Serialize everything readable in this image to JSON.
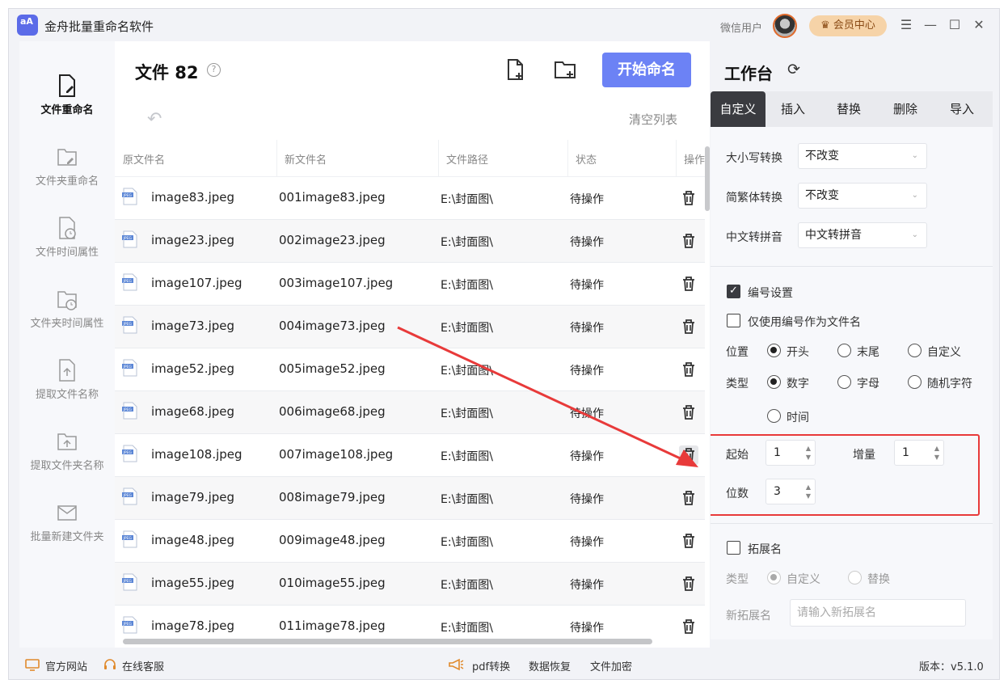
{
  "app": {
    "logo_text": "aA",
    "title": "金舟批量重命名软件",
    "user_name": "微信用户",
    "vip_label": "会员中心",
    "controls": [
      "menu-icon",
      "minimize-icon",
      "maximize-icon",
      "close-icon"
    ]
  },
  "nav": {
    "items": [
      {
        "label": "文件重命名",
        "icon": "file-edit-icon",
        "active": true
      },
      {
        "label": "文件夹重命名",
        "icon": "folder-edit-icon",
        "active": false
      },
      {
        "label": "文件时间属性",
        "icon": "file-clock-icon",
        "active": false
      },
      {
        "label": "文件夹时间属性",
        "icon": "folder-clock-icon",
        "active": false
      },
      {
        "label": "提取文件名称",
        "icon": "file-upload-icon",
        "active": false
      },
      {
        "label": "提取文件夹名称",
        "icon": "folder-upload-icon",
        "active": false
      },
      {
        "label": "批量新建文件夹",
        "icon": "mail-folder-icon",
        "active": false
      }
    ]
  },
  "files": {
    "title": "文件 82",
    "help_symbol": "?",
    "start_label": "开始命名",
    "clear_label": "清空列表",
    "undo_symbol": "↶",
    "columns": [
      "原文件名",
      "新文件名",
      "文件路径",
      "状态",
      "操作"
    ],
    "rows": [
      {
        "orig": "image83.jpeg",
        "new": "001image83.jpeg",
        "path": "E:\\封面图\\",
        "status": "待操作"
      },
      {
        "orig": "image23.jpeg",
        "new": "002image23.jpeg",
        "path": "E:\\封面图\\",
        "status": "待操作"
      },
      {
        "orig": "image107.jpeg",
        "new": "003image107.jpeg",
        "path": "E:\\封面图\\",
        "status": "待操作"
      },
      {
        "orig": "image73.jpeg",
        "new": "004image73.jpeg",
        "path": "E:\\封面图\\",
        "status": "待操作"
      },
      {
        "orig": "image52.jpeg",
        "new": "005image52.jpeg",
        "path": "E:\\封面图\\",
        "status": "待操作"
      },
      {
        "orig": "image68.jpeg",
        "new": "006image68.jpeg",
        "path": "E:\\封面图\\",
        "status": "待操作"
      },
      {
        "orig": "image108.jpeg",
        "new": "007image108.jpeg",
        "path": "E:\\封面图\\",
        "status": "待操作"
      },
      {
        "orig": "image79.jpeg",
        "new": "008image79.jpeg",
        "path": "E:\\封面图\\",
        "status": "待操作"
      },
      {
        "orig": "image48.jpeg",
        "new": "009image48.jpeg",
        "path": "E:\\封面图\\",
        "status": "待操作"
      },
      {
        "orig": "image55.jpeg",
        "new": "010image55.jpeg",
        "path": "E:\\封面图\\",
        "status": "待操作"
      },
      {
        "orig": "image78.jpeg",
        "new": "011image78.jpeg",
        "path": "E:\\封面图\\",
        "status": "待操作"
      }
    ]
  },
  "workspace": {
    "title": "工作台",
    "tabs": [
      "自定义",
      "插入",
      "替换",
      "删除",
      "导入"
    ],
    "case_label": "大小写转换",
    "case_value": "不改变",
    "trad_label": "简繁体转换",
    "trad_value": "不改变",
    "pinyin_label": "中文转拼音",
    "pinyin_value": "中文转拼音",
    "numbering_label": "编号设置",
    "only_number_label": "仅使用编号作为文件名",
    "position_label": "位置",
    "position_options": [
      "开头",
      "末尾",
      "自定义"
    ],
    "type_label": "类型",
    "type_options": [
      "数字",
      "字母",
      "随机字符",
      "时间"
    ],
    "start_label": "起始",
    "start_value": "1",
    "increment_label": "增量",
    "increment_value": "1",
    "digits_label": "位数",
    "digits_value": "3",
    "ext_label": "拓展名",
    "ext_type_label": "类型",
    "ext_type_options": [
      "自定义",
      "替换"
    ],
    "new_ext_label": "新拓展名",
    "new_ext_placeholder": "请输入新拓展名"
  },
  "footer": {
    "website": "官方网站",
    "service": "在线客服",
    "pdf": "pdf转换",
    "recovery": "数据恢复",
    "encrypt": "文件加密",
    "version": "版本：v5.1.0"
  },
  "colors": {
    "accent": "#6c82f5",
    "annotation": "#e83a3a",
    "vip": "#f6d3a8"
  }
}
